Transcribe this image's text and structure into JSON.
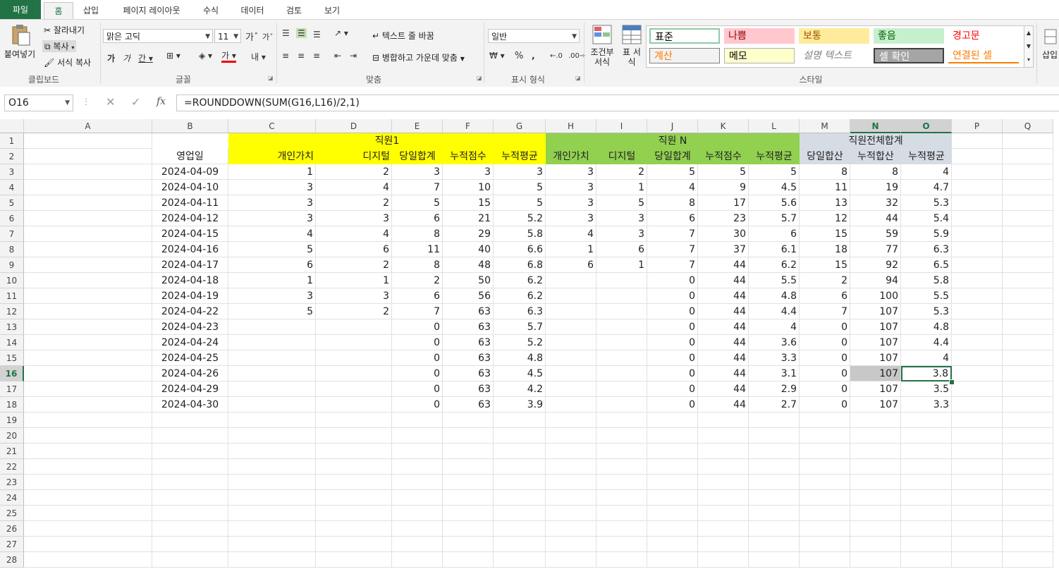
{
  "ribbon_tabs": [
    "파일",
    "홈",
    "삽입",
    "페이지 레이아웃",
    "수식",
    "데이터",
    "검토",
    "보기"
  ],
  "clipboard": {
    "paste": "붙여넣기",
    "cut": "잘라내기",
    "copy": "복사",
    "format_painter": "서식 복사",
    "label": "클립보드"
  },
  "font": {
    "name": "맑은 고딕",
    "size": "11",
    "label": "글꼴"
  },
  "alignment": {
    "wrap": "텍스트 줄 바꿈",
    "merge": "병합하고 가운데 맞춤",
    "label": "맞춤"
  },
  "number": {
    "format": "일반",
    "label": "표시 형식"
  },
  "style_group": {
    "conditional": "조건부 서식",
    "table": "표 서식",
    "label": "스타일",
    "styles": [
      {
        "name": "표준",
        "bg": "#ffffff",
        "fg": "#000000"
      },
      {
        "name": "나쁨",
        "bg": "#ffc7ce",
        "fg": "#9c0006"
      },
      {
        "name": "보통",
        "bg": "#ffeb9c",
        "fg": "#9c5700"
      },
      {
        "name": "좋음",
        "bg": "#c6efce",
        "fg": "#006100"
      },
      {
        "name": "경고문",
        "bg": "#ffffff",
        "fg": "#ff0000"
      },
      {
        "name": "계산",
        "bg": "#f2f2f2",
        "fg": "#fa7d00"
      },
      {
        "name": "메모",
        "bg": "#ffffcc",
        "fg": "#000000"
      },
      {
        "name": "설명 텍스트",
        "bg": "#ffffff",
        "fg": "#7f7f7f"
      },
      {
        "name": "셀 확인",
        "bg": "#a5a5a5",
        "fg": "#ffffff"
      },
      {
        "name": "연결된 셀",
        "bg": "#ffffff",
        "fg": "#fa7d00"
      }
    ]
  },
  "insert_label": "삽입",
  "formula_bar": {
    "name_box": "O16",
    "fx": "fx",
    "formula": "=ROUNDDOWN(SUM(G16,L16)/2,1)"
  },
  "columns": [
    "A",
    "B",
    "C",
    "D",
    "E",
    "F",
    "G",
    "H",
    "I",
    "J",
    "K",
    "L",
    "M",
    "N",
    "O",
    "P",
    "Q"
  ],
  "rows": [
    "1",
    "2",
    "3",
    "4",
    "5",
    "6",
    "7",
    "8",
    "9",
    "10",
    "11",
    "12",
    "13",
    "14",
    "15",
    "16",
    "17",
    "18",
    "19",
    "20",
    "21",
    "22",
    "23",
    "24",
    "25",
    "26",
    "27",
    "28"
  ],
  "header": {
    "group1": "직원1",
    "groupN": "직원 N",
    "groupTotal": "직원전체합계",
    "b2": "영업일",
    "sub1": [
      "개인가치",
      "디지털",
      "당일합계",
      "누적점수",
      "누적평균"
    ],
    "subN": [
      "개인가치",
      "디지털",
      "당일합계",
      "누적점수",
      "누적평균"
    ],
    "subT": [
      "당일합산",
      "누적합산",
      "누적평균"
    ]
  },
  "colors": {
    "yellow": "#ffff00",
    "green": "#92d050",
    "gray": "#d6dce4",
    "accent": "#217346",
    "selected": "#c8c8c8"
  },
  "data_rows": [
    [
      "2024-04-09",
      "1",
      "2",
      "3",
      "3",
      "3",
      "3",
      "2",
      "5",
      "5",
      "5",
      "8",
      "8",
      "4"
    ],
    [
      "2024-04-10",
      "3",
      "4",
      "7",
      "10",
      "5",
      "3",
      "1",
      "4",
      "9",
      "4.5",
      "11",
      "19",
      "4.7"
    ],
    [
      "2024-04-11",
      "3",
      "2",
      "5",
      "15",
      "5",
      "3",
      "5",
      "8",
      "17",
      "5.6",
      "13",
      "32",
      "5.3"
    ],
    [
      "2024-04-12",
      "3",
      "3",
      "6",
      "21",
      "5.2",
      "3",
      "3",
      "6",
      "23",
      "5.7",
      "12",
      "44",
      "5.4"
    ],
    [
      "2024-04-15",
      "4",
      "4",
      "8",
      "29",
      "5.8",
      "4",
      "3",
      "7",
      "30",
      "6",
      "15",
      "59",
      "5.9"
    ],
    [
      "2024-04-16",
      "5",
      "6",
      "11",
      "40",
      "6.6",
      "1",
      "6",
      "7",
      "37",
      "6.1",
      "18",
      "77",
      "6.3"
    ],
    [
      "2024-04-17",
      "6",
      "2",
      "8",
      "48",
      "6.8",
      "6",
      "1",
      "7",
      "44",
      "6.2",
      "15",
      "92",
      "6.5"
    ],
    [
      "2024-04-18",
      "1",
      "1",
      "2",
      "50",
      "6.2",
      "",
      "",
      "0",
      "44",
      "5.5",
      "2",
      "94",
      "5.8"
    ],
    [
      "2024-04-19",
      "3",
      "3",
      "6",
      "56",
      "6.2",
      "",
      "",
      "0",
      "44",
      "4.8",
      "6",
      "100",
      "5.5"
    ],
    [
      "2024-04-22",
      "5",
      "2",
      "7",
      "63",
      "6.3",
      "",
      "",
      "0",
      "44",
      "4.4",
      "7",
      "107",
      "5.3"
    ],
    [
      "2024-04-23",
      "",
      "",
      "0",
      "63",
      "5.7",
      "",
      "",
      "0",
      "44",
      "4",
      "0",
      "107",
      "4.8"
    ],
    [
      "2024-04-24",
      "",
      "",
      "0",
      "63",
      "5.2",
      "",
      "",
      "0",
      "44",
      "3.6",
      "0",
      "107",
      "4.4"
    ],
    [
      "2024-04-25",
      "",
      "",
      "0",
      "63",
      "4.8",
      "",
      "",
      "0",
      "44",
      "3.3",
      "0",
      "107",
      "4"
    ],
    [
      "2024-04-26",
      "",
      "",
      "0",
      "63",
      "4.5",
      "",
      "",
      "0",
      "44",
      "3.1",
      "0",
      "107",
      "3.8"
    ],
    [
      "2024-04-29",
      "",
      "",
      "0",
      "63",
      "4.2",
      "",
      "",
      "0",
      "44",
      "2.9",
      "0",
      "107",
      "3.5"
    ],
    [
      "2024-04-30",
      "",
      "",
      "0",
      "63",
      "3.9",
      "",
      "",
      "0",
      "44",
      "2.7",
      "0",
      "107",
      "3.3"
    ]
  ]
}
